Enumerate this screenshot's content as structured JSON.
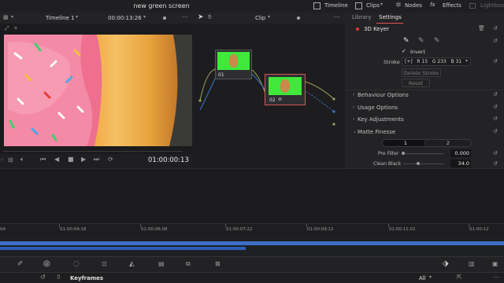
{
  "titlebar": {
    "project_name": "new green screen",
    "items": [
      "Timeline",
      "Clips",
      "Nodes",
      "Effects",
      "Lightbox"
    ]
  },
  "viewer": {
    "timeline_name": "Timeline 1",
    "timecode_top": "00:00:13:26",
    "timecode_bottom": "01:00:00:13"
  },
  "nodes": {
    "header_label": "Clip",
    "node1_label": "01",
    "node2_label": "02"
  },
  "inspector": {
    "tab_library": "Library",
    "tab_settings": "Settings",
    "effect_name": "3D Keyer",
    "invert_label": "Invert",
    "stroke_label": "Stroke",
    "stroke_value": "[+]   R 15   G 233   B 31",
    "delete_stroke": "Delete Stroke",
    "reset": "Reset",
    "sections": [
      "Behaviour Options",
      "Usage Options",
      "Key Adjustments",
      "Matte Finesse"
    ],
    "matte_btn1": "1",
    "matte_btn2": "2",
    "prefilter_label": "Pre Filter",
    "prefilter_value": "0.000",
    "cleanblack_label": "Clean Black",
    "cleanblack_value": "34.0"
  },
  "ruler": {
    "ticks": [
      "04",
      "01:00:04:18",
      "01:00:06:08",
      "01:00:07:22",
      "01:00:09:12",
      "01:00:11:02",
      "01:00:12"
    ]
  },
  "keyframes": {
    "label": "Keyframes",
    "filter_value": "All"
  },
  "colors": {
    "green_screen": "#3fe83a",
    "accent_red": "#e25555",
    "node_link_blue": "#3a78c8",
    "track_blue": "#3d6fc8"
  }
}
